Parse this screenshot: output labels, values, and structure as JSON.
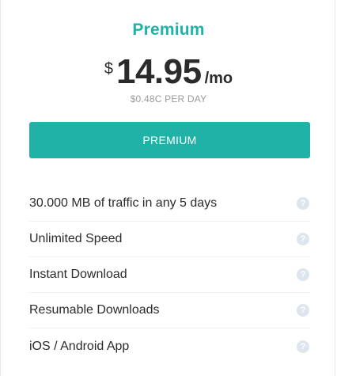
{
  "plan": {
    "title": "Premium",
    "currency": "$",
    "amount": "14.95",
    "period": "/mo",
    "per_day": "$0.48C PER DAY",
    "cta_label": "PREMIUM",
    "accent_color": "#20b2a6"
  },
  "features": [
    {
      "label": "30.000 MB of traffic in any 5 days",
      "icon": "help-icon"
    },
    {
      "label": "Unlimited Speed",
      "icon": "help-icon"
    },
    {
      "label": "Instant Download",
      "icon": "help-icon"
    },
    {
      "label": "Resumable Downloads",
      "icon": "help-icon"
    },
    {
      "label": "iOS / Android App",
      "icon": "help-icon"
    }
  ],
  "help_glyph": "?"
}
